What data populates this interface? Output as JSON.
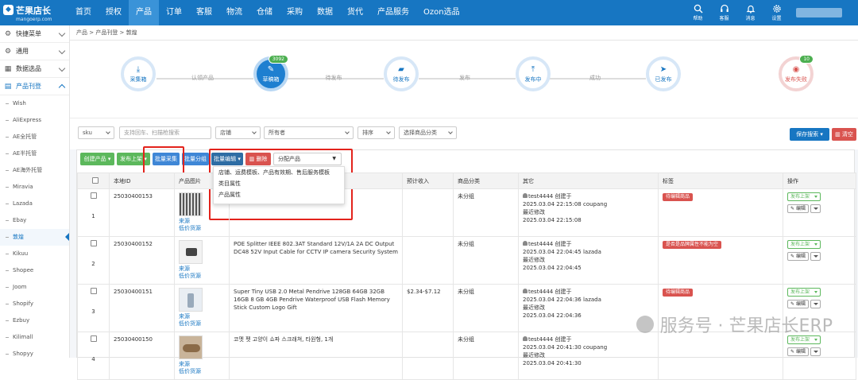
{
  "brand": {
    "name": "芒果店长",
    "domain": "mangoerp.com"
  },
  "nav": [
    "首页",
    "授权",
    "产品",
    "订单",
    "客服",
    "物流",
    "仓储",
    "采购",
    "数据",
    "货代",
    "产品服务",
    "Ozon选品"
  ],
  "nav_active": 2,
  "top_icons": [
    {
      "label": "帮助",
      "icon": "question-icon"
    },
    {
      "label": "客服",
      "icon": "headset-icon"
    },
    {
      "label": "消息",
      "icon": "bell-icon"
    },
    {
      "label": "设置",
      "icon": "gear-icon"
    }
  ],
  "sidebar": {
    "groups": [
      {
        "label": "快捷菜单",
        "icon": "gear-icon"
      },
      {
        "label": "通用",
        "icon": "gear-icon"
      },
      {
        "label": "数据选品",
        "icon": "chart-icon"
      },
      {
        "label": "产品刊登",
        "icon": "doc-icon"
      }
    ],
    "items": [
      "Wish",
      "AliExpress",
      "AE全托管",
      "AE半托管",
      "AE海外托管",
      "Miravia",
      "Lazada",
      "Ebay",
      "敦煌",
      "Kikuu",
      "Shopee",
      "Joom",
      "Shopify",
      "Ezbuy",
      "Kilimall",
      "Shopyy"
    ]
  },
  "breadcrumb": "产品 > 产品刊登 > 敦煌",
  "steps": {
    "items": [
      {
        "label": "采集箱"
      },
      {
        "label": "草稿箱",
        "badge": "3092"
      },
      {
        "label": "待发布"
      },
      {
        "label": "发布中"
      },
      {
        "label": "已发布"
      },
      {
        "label": "发布失败",
        "badge": "10"
      }
    ],
    "connectors": [
      "认领产品",
      "待发布",
      "发布",
      "成功"
    ]
  },
  "filters": {
    "sku": "sku",
    "search_placeholder": "支持回车、扫描枪搜索",
    "shop": "店铺",
    "owner": "所有者",
    "sort": "排序",
    "category": "选择商品分类",
    "save_search": "保存搜索",
    "clear": "清空"
  },
  "toolbar": {
    "create": "创建产品",
    "publish": "发布上架",
    "batch_collect": "批量采集",
    "batch_group": "批量分组",
    "batch_edit": "批量编辑",
    "delete": "删除",
    "assign": "分配产品"
  },
  "dropdown": [
    "店铺、运费模板、产品有效期、售后服务模板",
    "类目属性",
    "产品属性"
  ],
  "columns": [
    "本地ID",
    "产品图片",
    "预计收入",
    "商品分类",
    "其它",
    "标签",
    "操作"
  ],
  "rows": [
    {
      "num": "1",
      "id": "25030400153",
      "title": "",
      "price": "",
      "cat": "未分组",
      "creator": "test4444 创建于",
      "created": "2025.03.04 22:15:08 coupang",
      "modlabel": "最近修改",
      "modified": "2025.03.04 22:15:08",
      "tag": "待编辑商品"
    },
    {
      "num": "2",
      "id": "25030400152",
      "title": "POE Splitter IEEE 802.3AT Standard 12V/1A 2A DC Output DC48 52V Input Cable for CCTV IP camera Security System",
      "price": "",
      "cat": "未分组",
      "creator": "test4444 创建于",
      "created": "2025.03.04 22:04:45 lazada",
      "modlabel": "最近修改",
      "modified": "2025.03.04 22:04:45",
      "tag": "是否是品牌属性不能为空"
    },
    {
      "num": "3",
      "id": "25030400151",
      "title": "Super Tiny USB 2.0 Metal Pendrive 128GB 64GB 32GB 16GB 8 GB 4GB Pendrive Waterproof USB Flash Memory Stick Custom Logo Gift",
      "price": "$2.34-$7.12",
      "cat": "未分组",
      "creator": "test4444 创建于",
      "created": "2025.03.04 22:04:36 lazada",
      "modlabel": "最近修改",
      "modified": "2025.03.04 22:04:36",
      "tag": "待编辑商品"
    },
    {
      "num": "4",
      "id": "25030400150",
      "title": "코멧 펫 고양이 쇼파 스크래쳐, 타원형, 1개",
      "price": "",
      "cat": "未分组",
      "creator": "test4444 创建于",
      "created": "2025.03.04 20:41:30 coupang",
      "modlabel": "最近修改",
      "modified": "2025.03.04 20:41:30",
      "tag": ""
    }
  ],
  "row_links": {
    "source": "来源",
    "low_price": "低价货源"
  },
  "row_actions": {
    "publish": "发布上架",
    "edit": "编辑"
  },
  "watermark": "服务号 · 芒果店长ERP",
  "colors": {
    "primary": "#1776c2",
    "green": "#5cb85c",
    "red": "#d9534f",
    "highlight": "#e3231c"
  }
}
